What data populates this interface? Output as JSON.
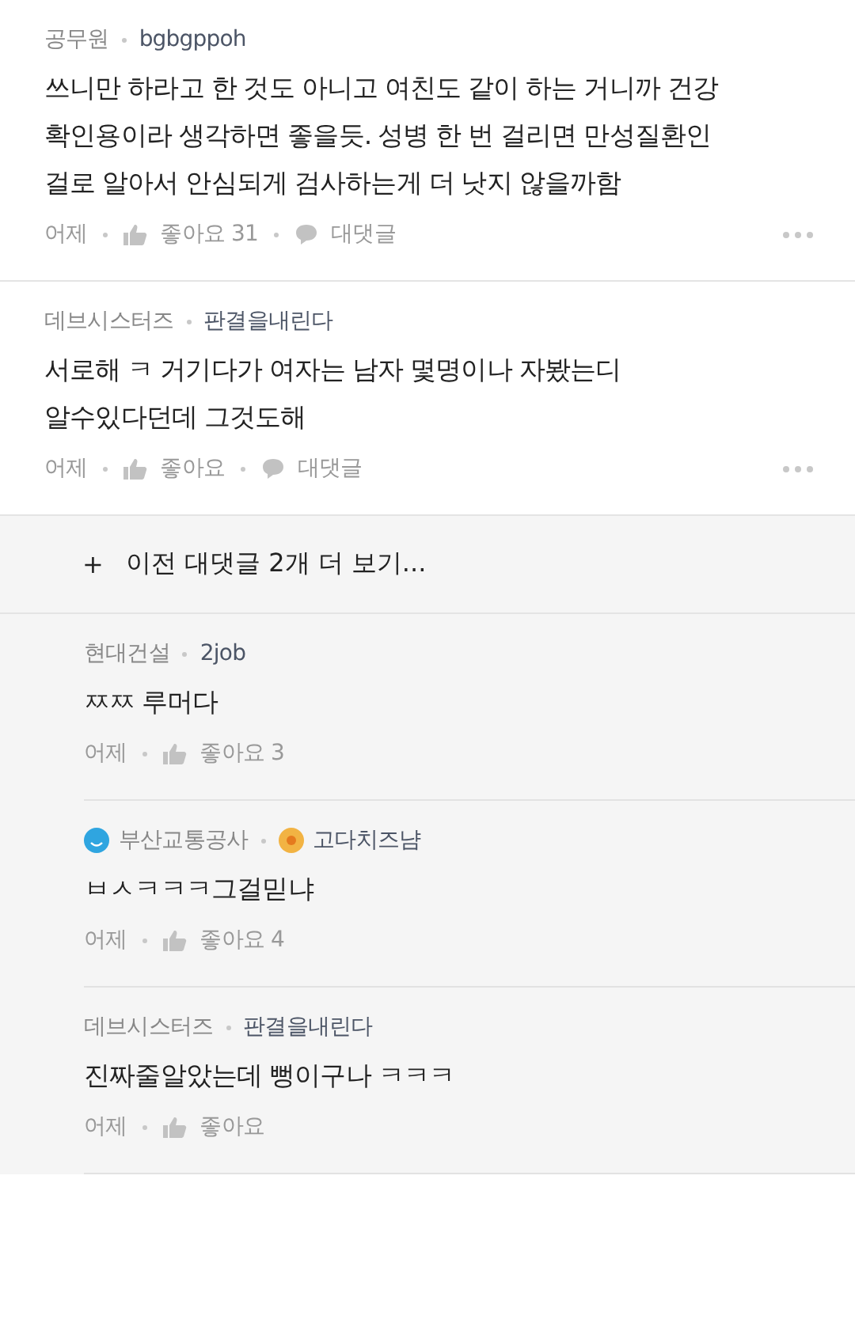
{
  "comments": [
    {
      "company": "공무원",
      "nickname": "bgbgppoh",
      "body": "쓰니만 하라고 한 것도 아니고 여친도 같이 하는 거니까 건강 확인용이라 생각하면 좋을듯. 성병 한 번 걸리면 만성질환인 걸로 알아서 안심되게 검사하는게 더 낫지 않을까함",
      "time": "어제",
      "like": "좋아요 31",
      "reply": "대댓글"
    },
    {
      "company": "데브시스터즈",
      "nickname": "판결을내린다",
      "body": "서로해 ㅋ 거기다가 여자는 남자 몇명이나 자봤는디 알수있다던데 그것도해",
      "time": "어제",
      "like": "좋아요",
      "reply": "대댓글"
    }
  ],
  "more_replies": {
    "icon": "+",
    "label": "이전 대댓글 2개 더 보기..."
  },
  "replies": [
    {
      "company": "현대건설",
      "nickname": "2job",
      "company_badge": false,
      "nickname_badge": false,
      "body": "ㅉㅉ 루머다",
      "time": "어제",
      "like": "좋아요 3"
    },
    {
      "company": "부산교통공사",
      "nickname": "고다치즈냠",
      "company_badge": true,
      "nickname_badge": true,
      "body": "ㅂㅅㅋㅋㅋ그걸믿냐",
      "time": "어제",
      "like": "좋아요 4"
    },
    {
      "company": "데브시스터즈",
      "nickname": "판결을내린다",
      "company_badge": false,
      "nickname_badge": false,
      "body": "진짜줄알았는데 뻥이구나 ㅋㅋㅋ",
      "time": "어제",
      "like": "좋아요"
    }
  ]
}
